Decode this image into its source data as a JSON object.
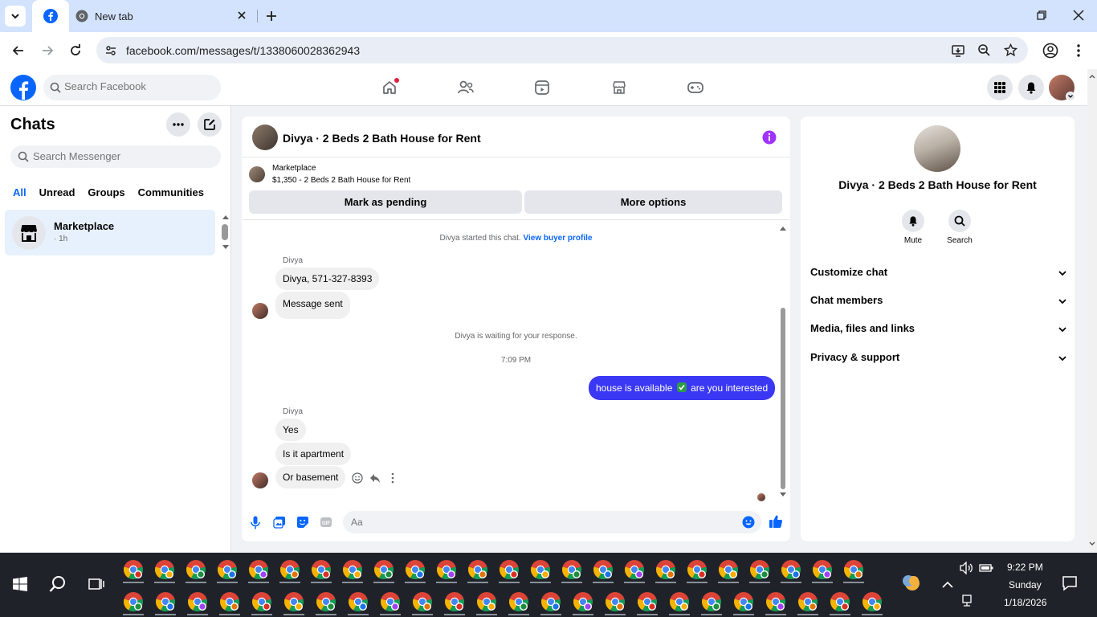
{
  "browser": {
    "tabs": [
      {
        "title": "",
        "favicon": "facebook-icon",
        "active": true
      },
      {
        "title": "New tab",
        "favicon": "chrome-icon",
        "active": false
      }
    ],
    "url": "facebook.com/messages/t/1338060028362943"
  },
  "facebook": {
    "search_placeholder": "Search Facebook",
    "brand_color": "#0866ff"
  },
  "chats": {
    "title": "Chats",
    "search_placeholder": "Search Messenger",
    "filters": [
      "All",
      "Unread",
      "Groups",
      "Communities"
    ],
    "active_filter": "All",
    "items": [
      {
        "name": "Marketplace",
        "time": "· 1h",
        "icon": "marketplace-store-icon"
      }
    ]
  },
  "conversation": {
    "title": "Divya · 2 Beds 2 Bath House for Rent",
    "listing": {
      "source": "Marketplace",
      "price_title": "$1,350 - 2 Beds 2 Bath House for Rent"
    },
    "buttons": {
      "pending": "Mark as pending",
      "more": "More options"
    },
    "started_text": "Divya started this chat.",
    "view_profile": "View buyer profile",
    "sender_name": "Divya",
    "msg1": "Divya, 571-327-8393",
    "msg2": "Message sent",
    "waiting_text": "Divya is waiting for your response.",
    "timestamp": "7:09 PM",
    "outgoing_part1": "house is available",
    "outgoing_part2": "are you interested",
    "sender_name2": "Divya",
    "reply1": "Yes",
    "reply2": "Is it apartment",
    "reply3": "Or basement",
    "composer_placeholder": "Aa",
    "outgoing_color": "#3b38f5"
  },
  "details": {
    "name": "Divya · 2 Beds 2 Bath House for Rent",
    "actions": [
      "Mute",
      "Search"
    ],
    "sections": [
      "Customize chat",
      "Chat members",
      "Media, files and links",
      "Privacy & support"
    ]
  },
  "taskbar": {
    "time": "9:22 PM",
    "day": "Sunday",
    "date": "1/18/2026"
  }
}
